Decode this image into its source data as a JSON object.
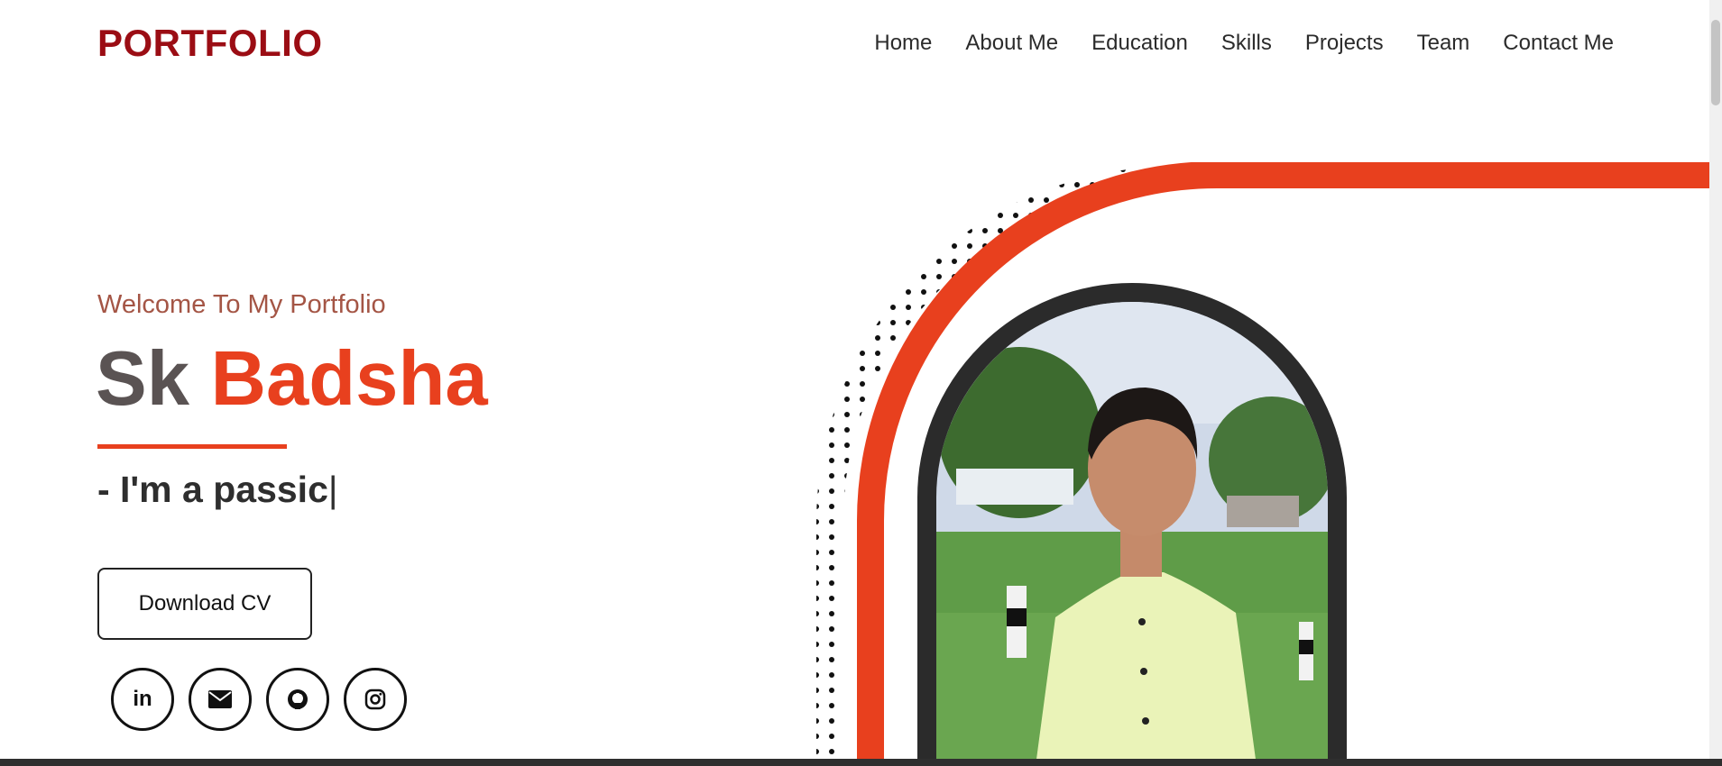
{
  "header": {
    "logo": "PORTFOLIO",
    "nav": [
      "Home",
      "About Me",
      "Education",
      "Skills",
      "Projects",
      "Team",
      "Contact Me"
    ]
  },
  "hero": {
    "welcome": "Welcome To My Portfolio",
    "first_name": "Sk",
    "last_name": "Badsha",
    "typed_text": "- I'm a passic",
    "cursor": "|",
    "download_label": "Download CV",
    "socials": [
      {
        "icon": "linkedin-icon",
        "text": "in"
      },
      {
        "icon": "envelope-icon",
        "text": ""
      },
      {
        "icon": "github-icon",
        "text": ""
      },
      {
        "icon": "instagram-icon",
        "text": ""
      }
    ]
  },
  "colors": {
    "brand": "#9b0d14",
    "accent": "#e8401e",
    "welcome": "#a45545",
    "ring": "#2b2b2b"
  }
}
